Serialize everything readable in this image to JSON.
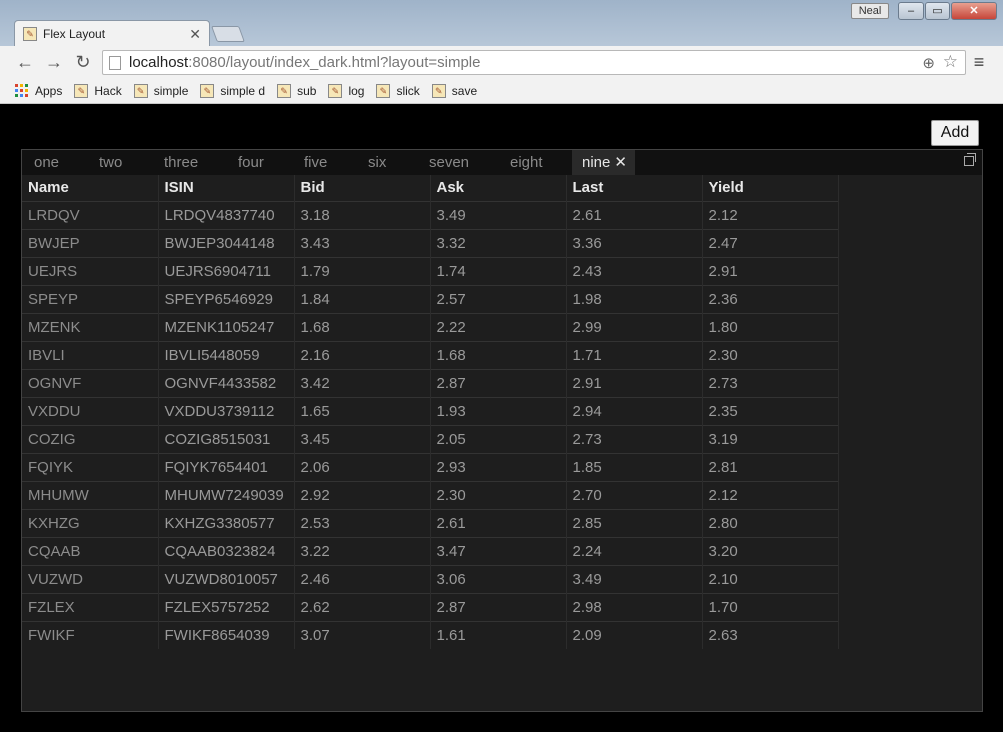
{
  "browser": {
    "tab_title": "Flex Layout",
    "tab_close": "✕",
    "user": "Neal",
    "url_host": "localhost",
    "url_path": ":8080/layout/index_dark.html?layout=simple",
    "bookmarks": [
      "Apps",
      "Hack",
      "simple",
      "simple d",
      "sub",
      "log",
      "slick",
      "save"
    ]
  },
  "page": {
    "add_label": "Add",
    "tabs": [
      {
        "label": "one"
      },
      {
        "label": "two"
      },
      {
        "label": "three"
      },
      {
        "label": "four"
      },
      {
        "label": "five"
      },
      {
        "label": "six"
      },
      {
        "label": "seven"
      },
      {
        "label": "eight"
      },
      {
        "label": "nine",
        "active": true
      }
    ],
    "columns": [
      "Name",
      "ISIN",
      "Bid",
      "Ask",
      "Last",
      "Yield"
    ],
    "rows": [
      [
        "LRDQV",
        "LRDQV4837740",
        "3.18",
        "3.49",
        "2.61",
        "2.12"
      ],
      [
        "BWJEP",
        "BWJEP3044148",
        "3.43",
        "3.32",
        "3.36",
        "2.47"
      ],
      [
        "UEJRS",
        "UEJRS6904711",
        "1.79",
        "1.74",
        "2.43",
        "2.91"
      ],
      [
        "SPEYP",
        "SPEYP6546929",
        "1.84",
        "2.57",
        "1.98",
        "2.36"
      ],
      [
        "MZENK",
        "MZENK1105247",
        "1.68",
        "2.22",
        "2.99",
        "1.80"
      ],
      [
        "IBVLI",
        "IBVLI5448059",
        "2.16",
        "1.68",
        "1.71",
        "2.30"
      ],
      [
        "OGNVF",
        "OGNVF4433582",
        "3.42",
        "2.87",
        "2.91",
        "2.73"
      ],
      [
        "VXDDU",
        "VXDDU3739112",
        "1.65",
        "1.93",
        "2.94",
        "2.35"
      ],
      [
        "COZIG",
        "COZIG8515031",
        "3.45",
        "2.05",
        "2.73",
        "3.19"
      ],
      [
        "FQIYK",
        "FQIYK7654401",
        "2.06",
        "2.93",
        "1.85",
        "2.81"
      ],
      [
        "MHUMW",
        "MHUMW7249039",
        "2.92",
        "2.30",
        "2.70",
        "2.12"
      ],
      [
        "KXHZG",
        "KXHZG3380577",
        "2.53",
        "2.61",
        "2.85",
        "2.80"
      ],
      [
        "CQAAB",
        "CQAAB0323824",
        "3.22",
        "3.47",
        "2.24",
        "3.20"
      ],
      [
        "VUZWD",
        "VUZWD8010057",
        "2.46",
        "3.06",
        "3.49",
        "2.10"
      ],
      [
        "FZLEX",
        "FZLEX5757252",
        "2.62",
        "2.87",
        "2.98",
        "1.70"
      ],
      [
        "FWIKF",
        "FWIKF8654039",
        "3.07",
        "1.61",
        "2.09",
        "2.63"
      ]
    ]
  }
}
